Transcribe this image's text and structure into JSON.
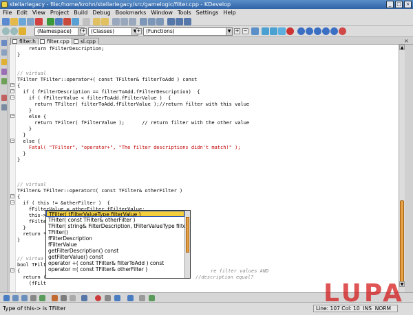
{
  "window": {
    "title": "stellarlegacy - file:/home/krohn/stellarlegacy/src/gamelogic/filter.cpp - KDevelop"
  },
  "menu": [
    "File",
    "Edit",
    "View",
    "Project",
    "Build",
    "Debug",
    "Bookmarks",
    "Window",
    "Tools",
    "Settings",
    "Help"
  ],
  "navigator": {
    "namespace_combo": "(Namespace)",
    "classes_combo": "(Classes)",
    "functions_combo": "(Functions)"
  },
  "tabs": [
    {
      "label": "filter.h"
    },
    {
      "label": "filter.cpp"
    },
    {
      "label": "sl.cpp"
    }
  ],
  "code_lines": [
    "    return fFilterDescription;",
    "}",
    "",
    "",
    "// virtual",
    "TFilter TFilter::operator+( const TFilter& filterToAdd ) const",
    "{",
    "  if ( fFilterDescription == filterToAdd.fFilterDescription)  {",
    "    if ( fFilterValue < filterToAdd.fFilterValue )  {",
    "      return TFilter( filterToAdd.fFilterValue );//return filter with this value",
    "    }",
    "    else {",
    "      return TFilter( fFilterValue );      // return filter with the other value",
    "    }",
    "  }",
    "  else {",
    "    Fatal( \"TFilter\", \"operator+\", \"The filter descriptions didn't match!\" );",
    "  }",
    "}",
    "",
    "",
    "",
    "// virtual",
    "TFilter& TFilter::operator=( const TFilter& otherFilter )",
    "{",
    "  if ( this != &otherFilter )  {",
    "    fFilterValue = otherFilter.fFilterValue;",
    "    this->",
    "    fFilte",
    "  }",
    "  return *",
    "}",
    "",
    "",
    "// virtua",
    "bool TFilt",
    "{",
    "  return (",
    "    (fFilt"
  ],
  "code_right_fragments": [
    "re filter values AND",
    "//description equal?"
  ],
  "completion": {
    "items": [
      "TFilter( tFilterValueType filterValue )",
      "TFilter( const TFilter& otherFilter )",
      "TFilter( string& FilterDescription, tFilterValueType filterValue )",
      "TFilter()",
      "fFilterDescription",
      "fFilterValue",
      "getFilterDescription()  const",
      "getFilterValue()  const",
      "operator +( const TFilter& filterToAdd ) const",
      "operator =( const TFilter& otherFilter )"
    ],
    "selected_index": 0
  },
  "status": {
    "message": "Type of this-> is TFilter",
    "position": "Line: 107 Col: 10  INS  NORM"
  },
  "watermark": "LUPA",
  "colors": {
    "selection": "#f5cf3b",
    "scroll_thumb": "#e7a14a",
    "title_bar": "#2f63a8",
    "comment": "#888888",
    "string": "#c00000"
  }
}
